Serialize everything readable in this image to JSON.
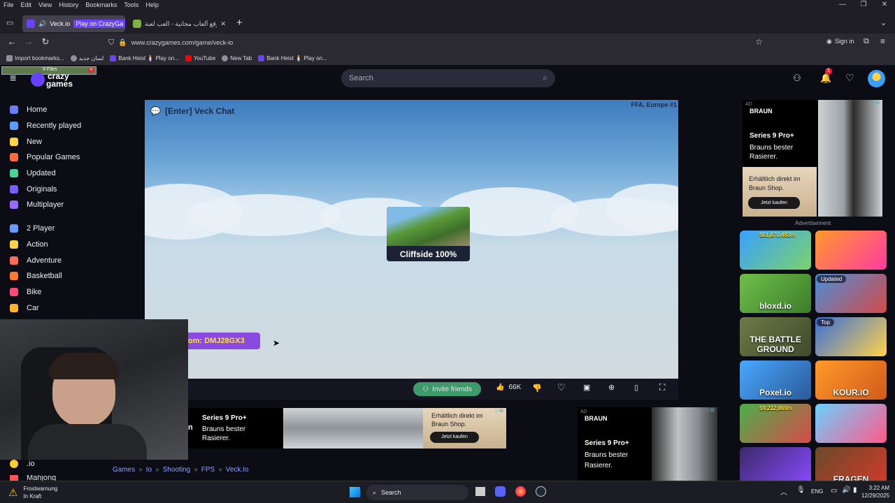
{
  "menubar": {
    "items": [
      "File",
      "Edit",
      "View",
      "History",
      "Bookmarks",
      "Tools",
      "Help"
    ]
  },
  "tabs": [
    {
      "title": "Veck.io",
      "subtitle": "Play on CrazyGa",
      "active": true
    },
    {
      "title": "موقع ألعاب مجانية - العب لعبة ...",
      "active": false
    }
  ],
  "nav": {
    "url": "www.crazygames.com/game/veck-io",
    "sign_in": "Sign in"
  },
  "bookmarks": [
    {
      "label": "Import bookmarks...",
      "color": "#8f8f9d"
    },
    {
      "label": "لسان جديد",
      "color": "#8f8f9d"
    },
    {
      "label": "Bank Heist 🕯️ Play on...",
      "color": "#6842ff"
    },
    {
      "label": "YouTube",
      "color": "#ff0000"
    },
    {
      "label": "New Tab",
      "color": "#8f8f9d"
    },
    {
      "label": "Bank Heist 🕯️ Play on...",
      "color": "#6842ff"
    }
  ],
  "site": {
    "logo_top": "crazy",
    "logo_bottom": "games",
    "overlay_files": "9 Files",
    "search_placeholder": "Search",
    "notif_count": "1"
  },
  "sidebar": {
    "items": [
      {
        "label": "Home",
        "icon": "home-icon",
        "color": "#6a7cff"
      },
      {
        "label": "Recently played",
        "icon": "clock-icon",
        "color": "#5b9cff"
      },
      {
        "label": "New",
        "icon": "sparkle-icon",
        "color": "#ffd24a"
      },
      {
        "label": "Popular Games",
        "icon": "fire-icon",
        "color": "#ff6a3a"
      },
      {
        "label": "Updated",
        "icon": "refresh-icon",
        "color": "#4ad29a"
      },
      {
        "label": "Originals",
        "icon": "crazy-icon",
        "color": "#7a5cff"
      },
      {
        "label": "Multiplayer",
        "icon": "people-icon",
        "color": "#9a6bff"
      },
      {
        "label": "2 Player",
        "icon": "two-player-icon",
        "color": "#6a9bff"
      },
      {
        "label": "Action",
        "icon": "sword-icon",
        "color": "#ffd24a"
      },
      {
        "label": "Adventure",
        "icon": "compass-icon",
        "color": "#ff6a5a"
      },
      {
        "label": "Basketball",
        "icon": "basketball-icon",
        "color": "#ff7a2a"
      },
      {
        "label": "Bike",
        "icon": "bike-icon",
        "color": "#ff4a7a"
      },
      {
        "label": "Car",
        "icon": "car-icon",
        "color": "#ffb42a"
      }
    ],
    "bottom_items": [
      {
        "label": ".io",
        "color": "#ffcc33"
      },
      {
        "label": "Mahjong",
        "color": "#ff5555"
      }
    ]
  },
  "game": {
    "chat_label": "[Enter] Veck Chat",
    "server": "FFA, Europe #1",
    "map_name": "Cliffside 100%",
    "room_code": "om: DMJ28GX3"
  },
  "gamebar": {
    "invite": "Invite friends",
    "likes": "66K"
  },
  "ads": {
    "brand": "BRAUN",
    "tag": "AD",
    "product": "Series 9 Pro+",
    "tagline": "Brauns bester Rasierer.",
    "cta_text": "Erhältlich direkt im Braun Shop.",
    "cta_button": "Jetzt kaufen",
    "label": "Advertisement",
    "bottom_left_letter": "n"
  },
  "right_thumbs": [
    {
      "label": "",
      "overlay": "$61,870,493/s",
      "badge": "",
      "colors": [
        "#3aa0ff",
        "#7bd36a"
      ]
    },
    {
      "label": "",
      "overlay": "",
      "badge": "",
      "colors": [
        "#ff9a2a",
        "#ff3aa0"
      ]
    },
    {
      "label": "bloxd.io",
      "overlay": "",
      "badge": "",
      "colors": [
        "#6fbf4a",
        "#3c7d2a"
      ]
    },
    {
      "label": "",
      "overlay": "",
      "badge": "Updated",
      "colors": [
        "#4a8fd8",
        "#d24a4a"
      ]
    },
    {
      "label": "THE BATTLE GROUND",
      "overlay": "",
      "badge": "",
      "colors": [
        "#6e7a45",
        "#3e4a2c"
      ]
    },
    {
      "label": "",
      "overlay": "",
      "badge": "Top",
      "colors": [
        "#3a6fd8",
        "#ffd24a"
      ]
    },
    {
      "label": "Poxel.io",
      "overlay": "",
      "badge": "",
      "colors": [
        "#4aa8ff",
        "#2a5a9a"
      ]
    },
    {
      "label": "KOUR.IO",
      "overlay": "",
      "badge": "",
      "colors": [
        "#ff9a2a",
        "#d25a1a"
      ]
    },
    {
      "label": "",
      "overlay": "$9,212,869/s",
      "badge": "",
      "colors": [
        "#4ab04a",
        "#d84a4a"
      ]
    },
    {
      "label": "",
      "overlay": "",
      "badge": "",
      "colors": [
        "#6ad0ff",
        "#ff5a8a"
      ]
    },
    {
      "label": "",
      "overlay": "",
      "badge": "",
      "colors": [
        "#3a2a6a",
        "#8a4aff"
      ]
    },
    {
      "label": "FRAGEN",
      "overlay": "",
      "badge": "",
      "colors": [
        "#6a4a2a",
        "#d23a2a"
      ]
    }
  ],
  "breadcrumb": [
    "Games",
    "Io",
    "Shooting",
    "FPS",
    "Veck.Io"
  ],
  "taskbar": {
    "weather_title": "Frostwarnung",
    "weather_sub": "In Kraft",
    "search": "Search",
    "lang": "ENG",
    "time": "3:22 AM",
    "date": "12/29/2025"
  }
}
